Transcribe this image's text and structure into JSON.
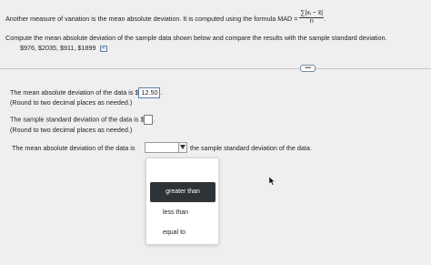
{
  "question": {
    "intro_prefix": "Another measure of variation is the mean absolute deviation. It is computed using the formula MAD =",
    "formula": {
      "numerator": "∑|xᵢ − x̄|",
      "denominator": "n"
    },
    "intro_suffix": ".",
    "instruction": "Compute the mean absolute deviation of the sample data shown below and compare the results with the sample standard deviation.",
    "data_values": "$976, $2035, $911, $1899"
  },
  "more_button_label": "•••••",
  "answers": {
    "mad": {
      "label": "The mean absolute deviation of the data is $",
      "value": "12.50",
      "suffix": ".",
      "hint": "(Round to two decimal places as needed.)"
    },
    "sd": {
      "label": "The sample standard deviation of the data is $",
      "value": "",
      "suffix": ".",
      "hint": "(Round to two decimal places as needed.)"
    },
    "compare": {
      "prefix": "The mean absolute deviation of the data is",
      "suffix": "the sample standard deviation of the data."
    }
  },
  "dropdown": {
    "options": [
      "greater than",
      "less than",
      "equal to"
    ],
    "highlighted": "greater than"
  },
  "colors": {
    "background": "#efefef",
    "selected_option_bg": "#2e3338",
    "answer_box_border": "#5b7fa8"
  }
}
